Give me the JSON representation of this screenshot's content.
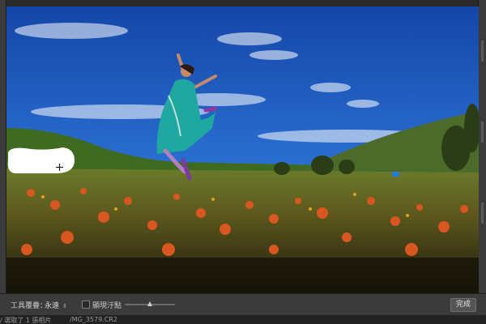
{
  "toolbar": {
    "tool_overlay_label": "工具覆疊：",
    "tool_overlay_value": "永遠",
    "show_grid_label": "顯現汙點",
    "done_label": "完成"
  },
  "filmstrip": {
    "selection_text": "/ 選取了 1 張相片",
    "filename": "/MG_3579.CR2"
  },
  "icons": {
    "spot_cursor": "crosshair-icon",
    "dropdown": "chevron-updown-icon"
  },
  "colors": {
    "toolbar_bg": "#3b3b3b",
    "panel_bg": "#303030",
    "sky": "#1f5fc4"
  }
}
